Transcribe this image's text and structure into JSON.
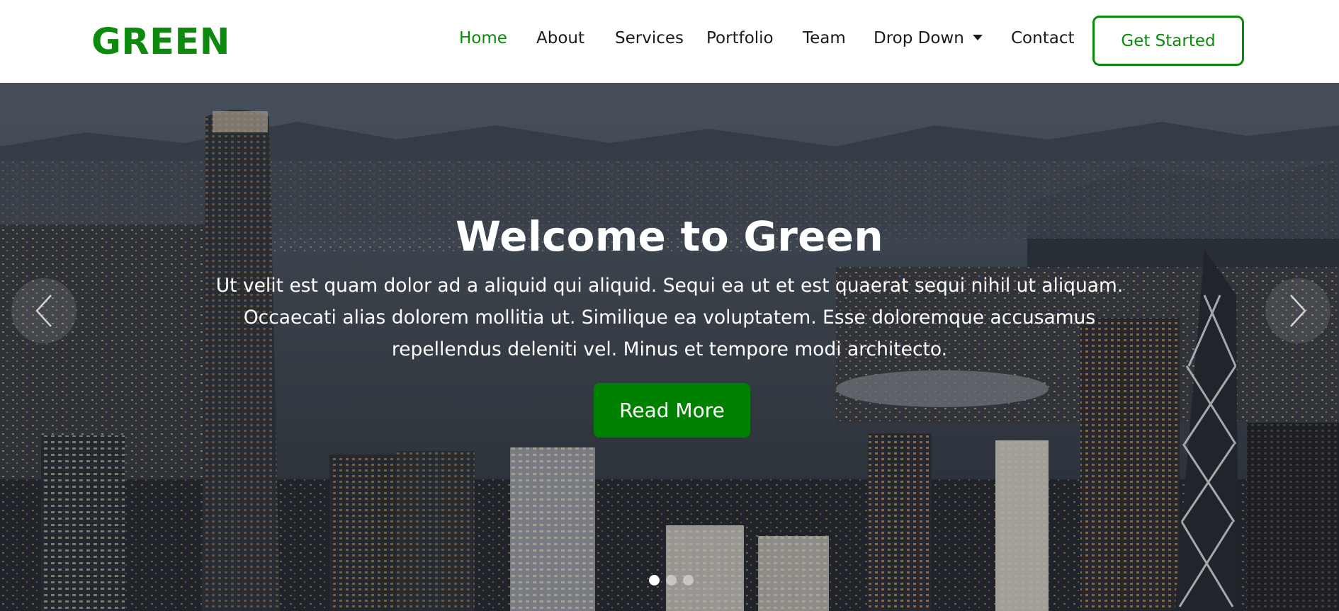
{
  "brand": {
    "logo_text": "GREEN",
    "accent_color": "#0b8a0b",
    "button_color": "#008000"
  },
  "nav": {
    "items": [
      {
        "label": "Home",
        "active": true
      },
      {
        "label": "About"
      },
      {
        "label": "Services"
      },
      {
        "label": "Portfolio"
      },
      {
        "label": "Team"
      },
      {
        "label": "Drop Down",
        "has_dropdown": true
      },
      {
        "label": "Contact"
      }
    ],
    "cta_label": "Get Started"
  },
  "hero": {
    "title": "Welcome to Green",
    "text": "Ut velit est quam dolor ad a aliquid qui aliquid. Sequi ea ut et est quaerat sequi nihil ut aliquam. Occaecati alias dolorem mollitia ut. Similique ea voluptatem. Esse doloremque accusamus repellendus deleniti vel. Minus et tempore modi architecto.",
    "button_label": "Read More",
    "background_image": "night city skyline with illuminated skyscrapers and harbor",
    "prev_icon": "chevron-left-icon",
    "next_icon": "chevron-right-icon",
    "slides_total": 3,
    "active_slide": 1
  }
}
